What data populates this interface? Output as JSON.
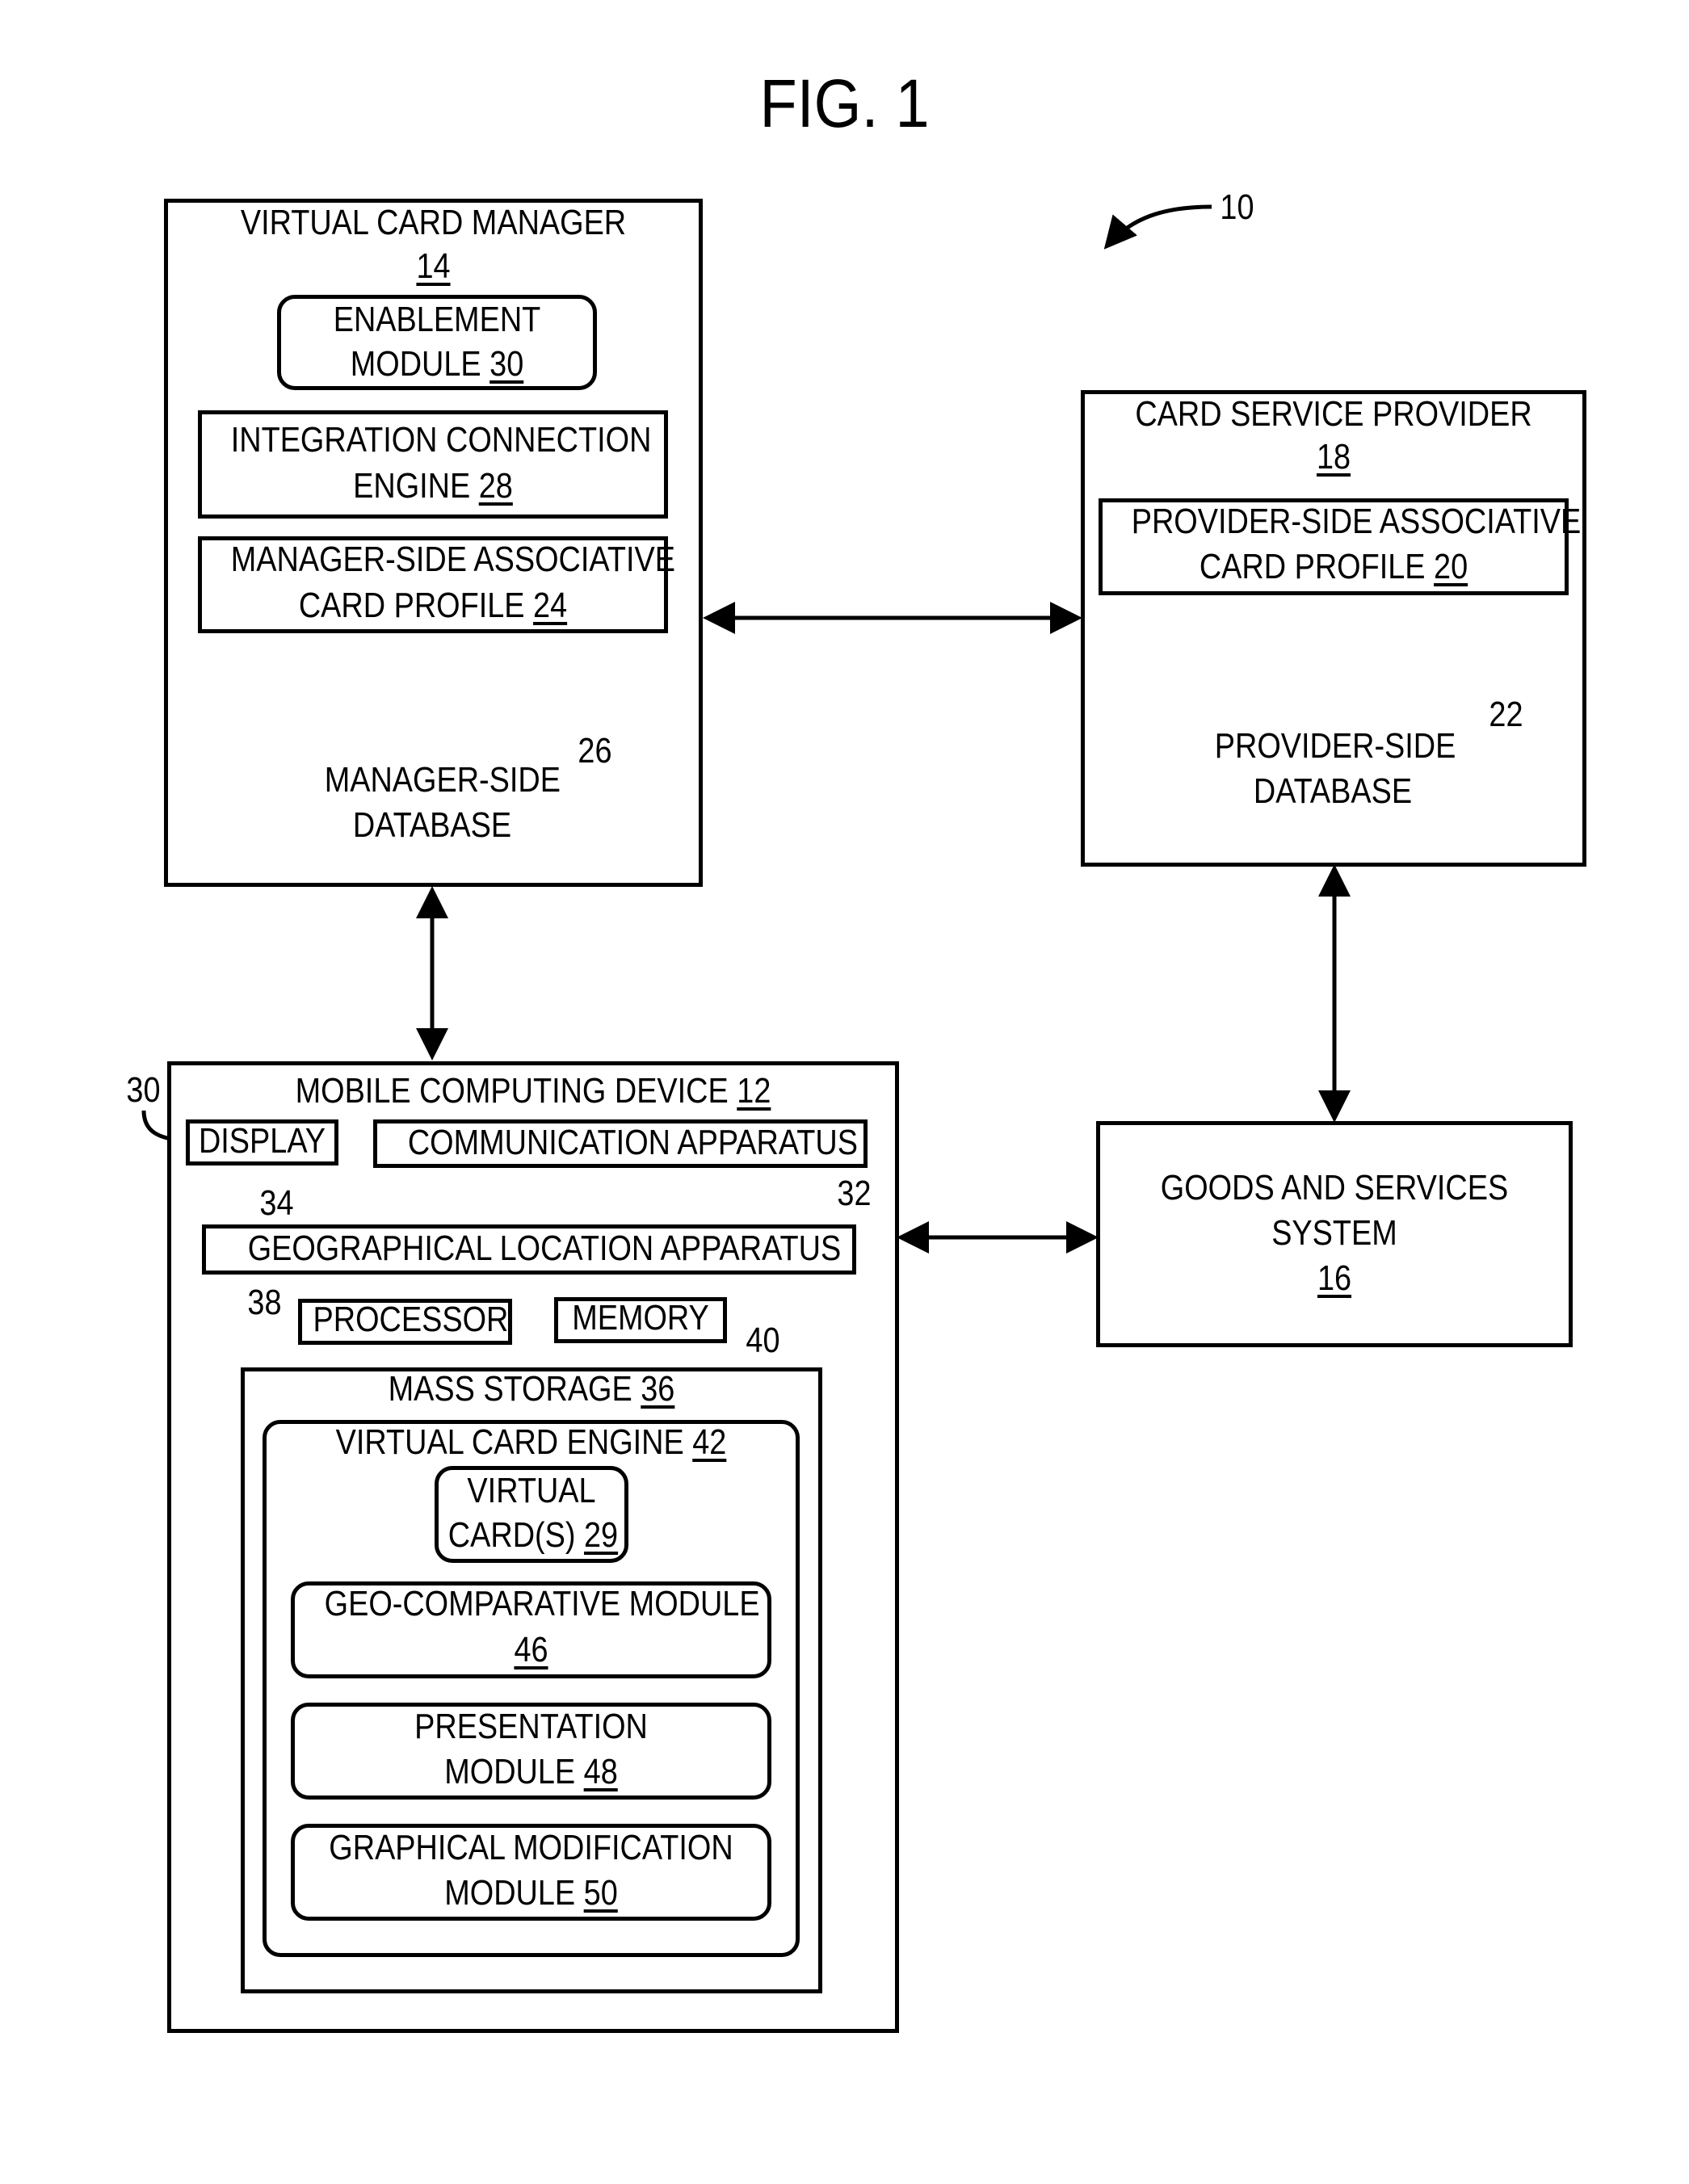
{
  "figure": {
    "title": "FIG. 1",
    "ref": "10"
  },
  "manager": {
    "name": "VIRTUAL CARD MANAGER",
    "num": "14",
    "enable": {
      "l1": "ENABLEMENT",
      "l2": "MODULE",
      "num": "30"
    },
    "ice": {
      "l1": "INTEGRATION CONNECTION",
      "l2": "ENGINE",
      "num": "28"
    },
    "profile": {
      "l1": "MANAGER-SIDE ASSOCIATIVE",
      "l2": "CARD PROFILE",
      "num": "24"
    },
    "db": {
      "l1": "MANAGER-SIDE",
      "l2": "DATABASE",
      "ref": "26"
    }
  },
  "provider": {
    "name": "CARD SERVICE PROVIDER",
    "num": "18",
    "profile": {
      "l1": "PROVIDER-SIDE ASSOCIATIVE",
      "l2": "CARD PROFILE",
      "num": "20"
    },
    "db": {
      "l1": "PROVIDER-SIDE",
      "l2": "DATABASE",
      "ref": "22"
    }
  },
  "goods": {
    "l1": "GOODS AND SERVICES",
    "l2": "SYSTEM",
    "num": "16"
  },
  "device": {
    "name": "MOBILE COMPUTING DEVICE",
    "num": "12",
    "display": {
      "label": "DISPLAY",
      "ref": "30"
    },
    "comm": {
      "label": "COMMUNICATION APPARATUS",
      "ref": "32"
    },
    "geo": {
      "label": "GEOGRAPHICAL LOCATION APPARATUS",
      "ref": "34"
    },
    "processor": {
      "label": "PROCESSOR",
      "ref": "38"
    },
    "memory": {
      "label": "MEMORY",
      "ref": "40"
    },
    "mass": {
      "label": "MASS STORAGE",
      "num": "36"
    },
    "engine": {
      "label": "VIRTUAL CARD ENGINE",
      "num": "42"
    },
    "vcard": {
      "l1": "VIRTUAL",
      "l2": "CARD(S)",
      "num": "29"
    },
    "geocomp": {
      "l1": "GEO-COMPARATIVE MODULE",
      "num": "46"
    },
    "present": {
      "l1": "PRESENTATION",
      "l2": "MODULE",
      "num": "48"
    },
    "graph": {
      "l1": "GRAPHICAL MODIFICATION",
      "l2": "MODULE",
      "num": "50"
    }
  }
}
